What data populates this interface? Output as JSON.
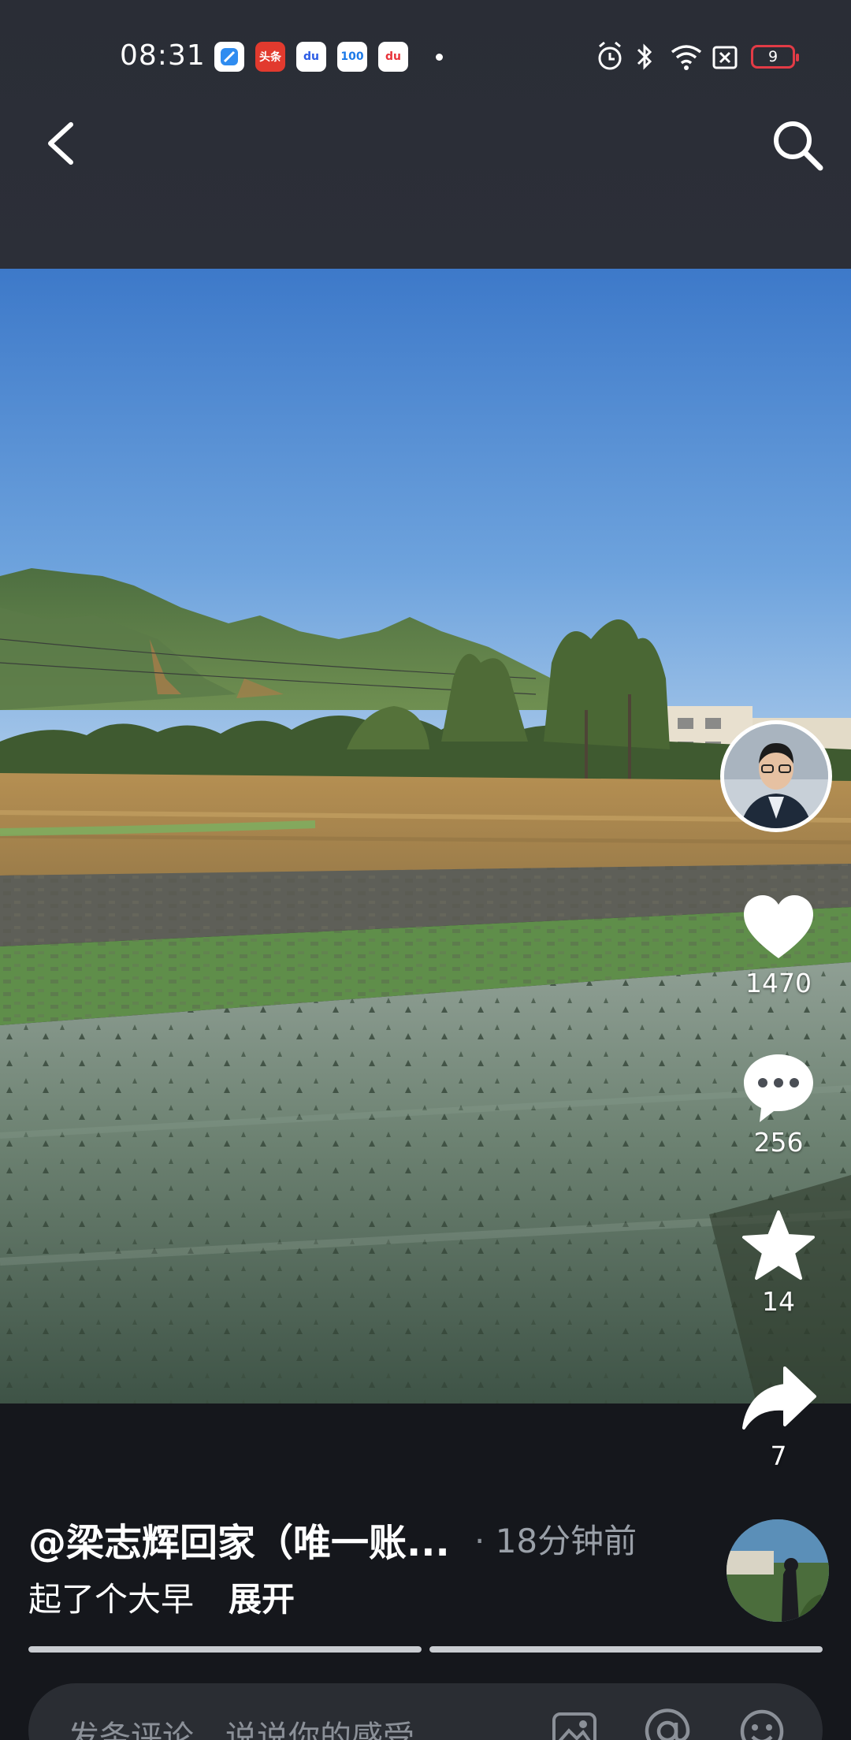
{
  "status_bar": {
    "time": "08:31",
    "apps": [
      {
        "name": "browser-app-icon",
        "label": "",
        "bg": "#2f8cf0"
      },
      {
        "name": "toutiao-app-icon",
        "label": "头条",
        "bg": "#e23a2e"
      },
      {
        "name": "baidu-app-icon",
        "label": "du",
        "bg": "#2c5ce5"
      },
      {
        "name": "kuaidi100-app-icon",
        "label": "100",
        "bg": "#1c7ae8"
      },
      {
        "name": "map-app-icon",
        "label": "du",
        "bg": "#e8333a"
      }
    ],
    "battery_level": "9",
    "battery_color": "#e23b46"
  },
  "post": {
    "author_handle": "@梁志辉回家（唯一账...",
    "posted_time": "18分钟前",
    "caption": "起了个大早",
    "expand_label": "展开"
  },
  "actions": {
    "likes": "1470",
    "comments": "256",
    "favorites": "14",
    "shares": "7"
  },
  "progress": {
    "segments": [
      1.0,
      1.0
    ]
  },
  "comment_bar": {
    "placeholder": "发条评论，说说你的感受"
  },
  "colors": {
    "header_bg": "#2c2f38",
    "page_bg": "#15171c",
    "muted_text": "#9aa0a8"
  }
}
